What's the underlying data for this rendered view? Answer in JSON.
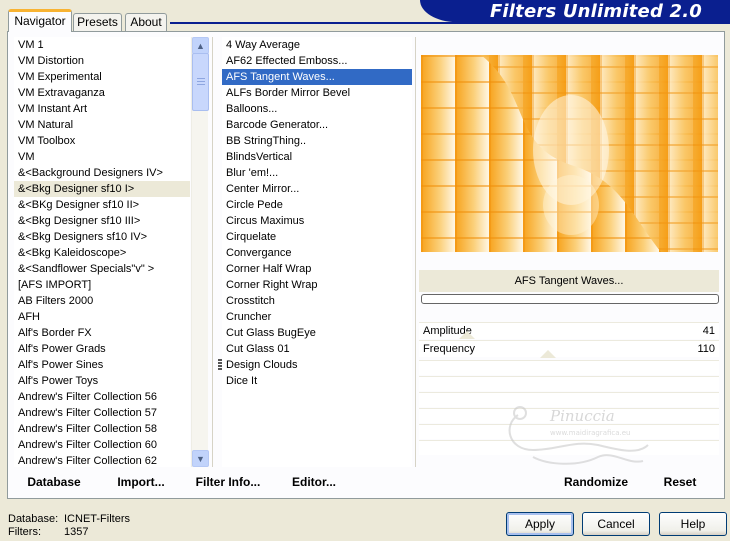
{
  "window": {
    "title": "Filters Unlimited 2.0"
  },
  "tabs": [
    {
      "label": "Navigator",
      "active": true
    },
    {
      "label": "Presets",
      "active": false
    },
    {
      "label": "About",
      "active": false
    }
  ],
  "categories": [
    "VM 1",
    "VM Distortion",
    "VM Experimental",
    "VM Extravaganza",
    "VM Instant Art",
    "VM Natural",
    "VM Toolbox",
    "VM",
    "&<Background Designers IV>",
    "&<Bkg Designer sf10 I>",
    "&<BKg Designer sf10 II>",
    "&<Bkg Designer sf10 III>",
    "&<Bkg Designers sf10 IV>",
    "&<Bkg Kaleidoscope>",
    "&<Sandflower Specials\"v\" >",
    "[AFS IMPORT]",
    "AB Filters 2000",
    "AFH",
    "Alf's Border FX",
    "Alf's Power Grads",
    "Alf's Power Sines",
    "Alf's Power Toys",
    "Andrew's Filter Collection 56",
    "Andrew's Filter Collection 57",
    "Andrew's Filter Collection 58",
    "Andrew's Filter Collection 60",
    "Andrew's Filter Collection 62"
  ],
  "filters": [
    "4 Way Average",
    "AF62 Effected Emboss...",
    "AFS Tangent Waves...",
    "ALFs Border Mirror Bevel",
    "Balloons...",
    "Barcode Generator...",
    "BB StringThing..",
    "BlindsVertical",
    "Blur 'em!...",
    "Center Mirror...",
    "Circle Pede",
    "Circus Maximus",
    "Cirquelate",
    "Convergance",
    "Corner Half Wrap",
    "Corner Right Wrap",
    "Crosstitch",
    "Cruncher",
    "Cut Glass  BugEye",
    "Cut Glass 01",
    "Design Clouds",
    "Dice It"
  ],
  "selected_filter_label": "AFS Tangent Waves...",
  "parameters": [
    {
      "label": "Amplitude",
      "value": "41",
      "level": 41
    },
    {
      "label": "Frequency",
      "value": "110",
      "level": 110
    }
  ],
  "buttons": {
    "database": "Database",
    "import": "Import...",
    "filter_info": "Filter Info...",
    "editor": "Editor...",
    "randomize": "Randomize",
    "reset": "Reset",
    "apply": "Apply",
    "cancel": "Cancel",
    "help": "Help"
  },
  "status": {
    "database_label": "Database:",
    "database_value": "ICNET-Filters",
    "filters_label": "Filters:",
    "filters_value": "1357"
  },
  "watermark": {
    "text": "Pinuccia",
    "url": "www.maidiragrafica.eu"
  },
  "colors": {
    "banner": "#0a1f8f",
    "selection": "#316ac5",
    "preview_orange": "#f7a21b",
    "active_tab": "#f8b332"
  }
}
